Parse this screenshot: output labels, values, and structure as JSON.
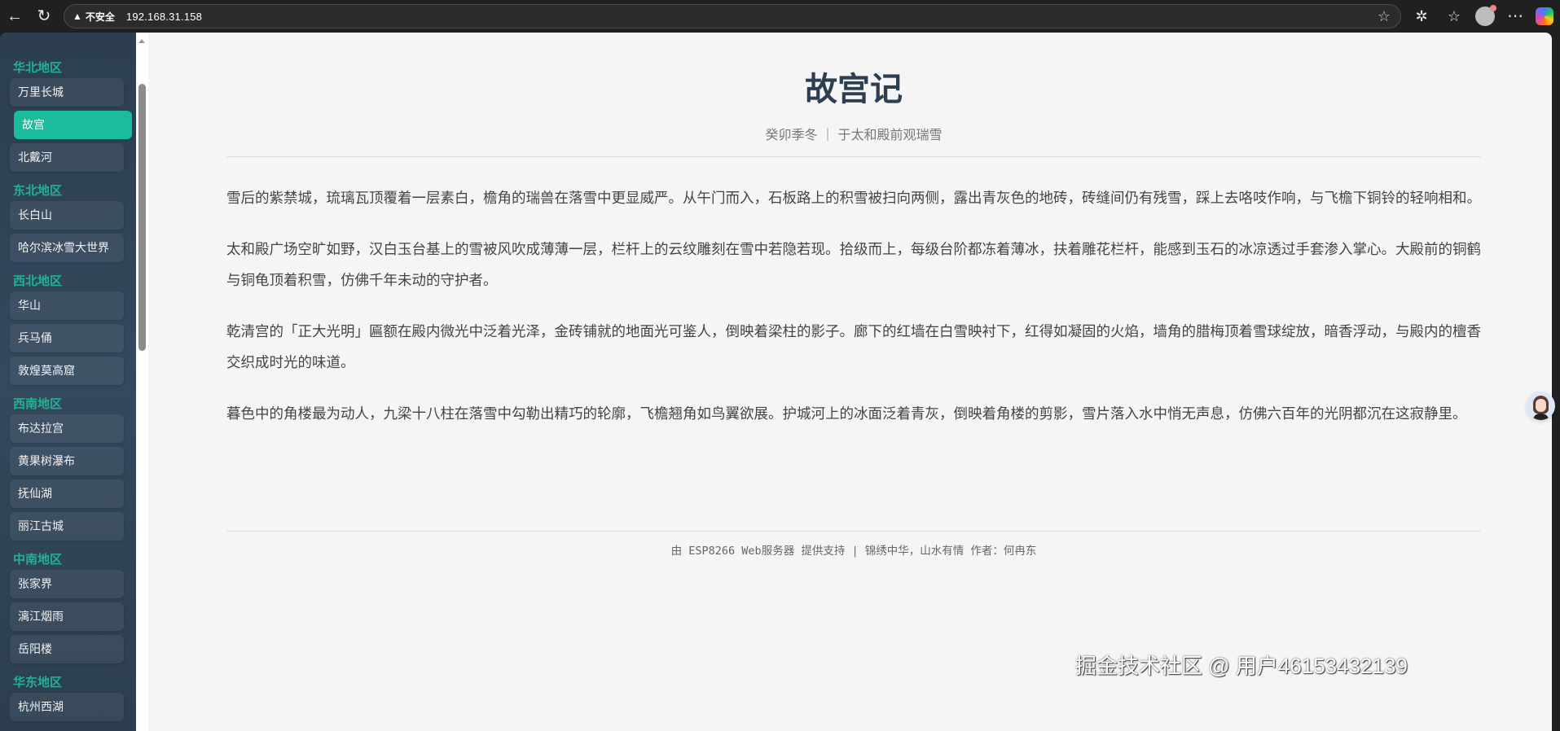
{
  "browser": {
    "security_label": "不安全",
    "url": "192.168.31.158"
  },
  "sidebar": {
    "groups": [
      {
        "title": "华北地区",
        "items": [
          "万里长城",
          "故宫",
          "北戴河"
        ]
      },
      {
        "title": "东北地区",
        "items": [
          "长白山",
          "哈尔滨冰雪大世界"
        ]
      },
      {
        "title": "西北地区",
        "items": [
          "华山",
          "兵马俑",
          "敦煌莫高窟"
        ]
      },
      {
        "title": "西南地区",
        "items": [
          "布达拉宫",
          "黄果树瀑布",
          "抚仙湖",
          "丽江古城"
        ]
      },
      {
        "title": "中南地区",
        "items": [
          "张家界",
          "漓江烟雨",
          "岳阳楼"
        ]
      },
      {
        "title": "华东地区",
        "items": [
          "杭州西湖"
        ]
      }
    ],
    "active_item": "故宫"
  },
  "article": {
    "title": "故宫记",
    "subtitle": "癸卯季冬 ｜ 于太和殿前观瑞雪",
    "paragraphs": [
      "雪后的紫禁城，琉璃瓦顶覆着一层素白，檐角的瑞兽在落雪中更显威严。从午门而入，石板路上的积雪被扫向两侧，露出青灰色的地砖，砖缝间仍有残雪，踩上去咯吱作响，与飞檐下铜铃的轻响相和。",
      "太和殿广场空旷如野，汉白玉台基上的雪被风吹成薄薄一层，栏杆上的云纹雕刻在雪中若隐若现。拾级而上，每级台阶都冻着薄冰，扶着雕花栏杆，能感到玉石的冰凉透过手套渗入掌心。大殿前的铜鹤与铜龟顶着积雪，仿佛千年未动的守护者。",
      "乾清宫的「正大光明」匾额在殿内微光中泛着光泽，金砖铺就的地面光可鉴人，倒映着梁柱的影子。廊下的红墙在白雪映衬下，红得如凝固的火焰，墙角的腊梅顶着雪球绽放，暗香浮动，与殿内的檀香交织成时光的味道。",
      "暮色中的角楼最为动人，九梁十八柱在落雪中勾勒出精巧的轮廓，飞檐翘角如鸟翼欲展。护城河上的冰面泛着青灰，倒映着角楼的剪影，雪片落入水中悄无声息，仿佛六百年的光阴都沉在这寂静里。"
    ],
    "footer": "由 ESP8266 Web服务器 提供支持 | 锦绣中华，山水有情 作者：何冉东"
  },
  "watermark": "掘金技术社区 @ 用户46153432139",
  "colors": {
    "accent": "#1abc9c",
    "sidebar_bg": "#2c3e50",
    "title": "#2c3e50"
  }
}
